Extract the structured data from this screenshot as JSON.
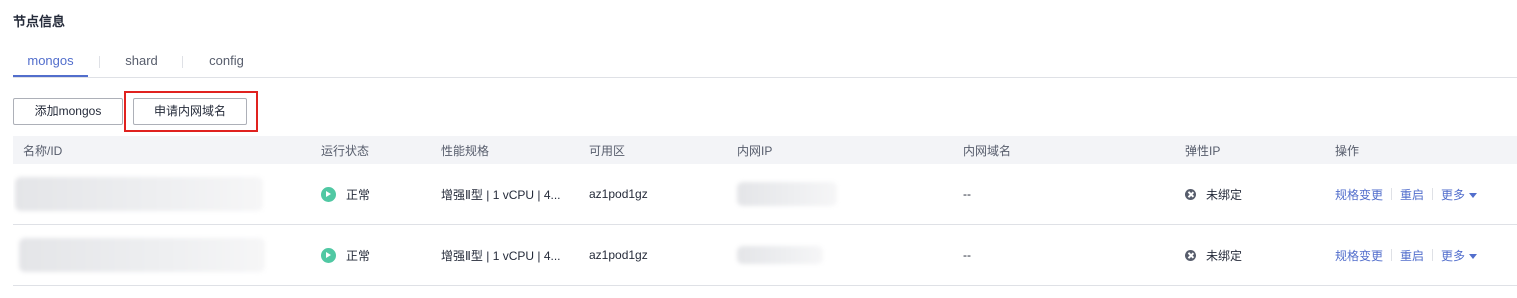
{
  "section": {
    "title": "节点信息"
  },
  "tabs": [
    {
      "label": "mongos",
      "active": true
    },
    {
      "label": "shard",
      "active": false
    },
    {
      "label": "config",
      "active": false
    }
  ],
  "toolbar": {
    "add_label": "添加mongos",
    "apply_dns_label": "申请内网域名"
  },
  "table": {
    "columns": [
      "名称/ID",
      "运行状态",
      "性能规格",
      "可用区",
      "内网IP",
      "内网域名",
      "弹性IP",
      "操作"
    ],
    "rows": [
      {
        "status": "正常",
        "spec": "增强Ⅱ型 | 1 vCPU | 4...",
        "az": "az1pod1gz",
        "dns": "--",
        "eip": "未绑定",
        "ops": {
          "resize": "规格变更",
          "restart": "重启",
          "more": "更多"
        }
      },
      {
        "status": "正常",
        "spec": "增强Ⅱ型 | 1 vCPU | 4...",
        "az": "az1pod1gz",
        "dns": "--",
        "eip": "未绑定",
        "ops": {
          "resize": "规格变更",
          "restart": "重启",
          "more": "更多"
        }
      }
    ]
  },
  "colors": {
    "accent": "#526ecc",
    "status_normal": "#50c8a3",
    "highlight_box": "#e0221f"
  }
}
